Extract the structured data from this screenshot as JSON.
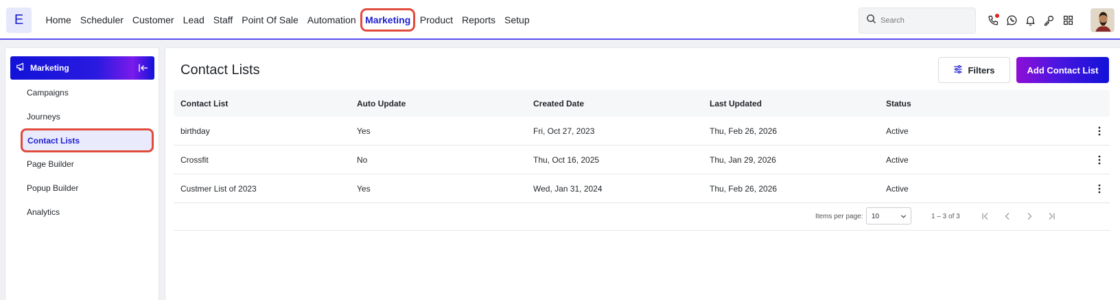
{
  "app": {
    "logo_letter": "E"
  },
  "nav": {
    "items": [
      {
        "label": "Home",
        "active": false
      },
      {
        "label": "Scheduler",
        "active": false
      },
      {
        "label": "Customer",
        "active": false
      },
      {
        "label": "Lead",
        "active": false
      },
      {
        "label": "Staff",
        "active": false
      },
      {
        "label": "Point Of Sale",
        "active": false
      },
      {
        "label": "Automation",
        "active": false
      },
      {
        "label": "Marketing",
        "active": true
      },
      {
        "label": "Product",
        "active": false
      },
      {
        "label": "Reports",
        "active": false
      },
      {
        "label": "Setup",
        "active": false
      }
    ],
    "search_placeholder": "Search",
    "icons": [
      "phone-icon",
      "whatsapp-icon",
      "bell-icon",
      "key-icon",
      "apps-grid-icon"
    ]
  },
  "sidebar": {
    "title": "Marketing",
    "items": [
      {
        "label": "Campaigns",
        "active": false
      },
      {
        "label": "Journeys",
        "active": false
      },
      {
        "label": "Contact Lists",
        "active": true
      },
      {
        "label": "Page Builder",
        "active": false
      },
      {
        "label": "Popup Builder",
        "active": false
      },
      {
        "label": "Analytics",
        "active": false
      }
    ]
  },
  "main": {
    "title": "Contact Lists",
    "filters_label": "Filters",
    "add_label": "Add Contact List",
    "table": {
      "headers": [
        "Contact List",
        "Auto Update",
        "Created Date",
        "Last Updated",
        "Status"
      ],
      "rows": [
        [
          "birthday",
          "Yes",
          "Fri, Oct 27, 2023",
          "Thu, Feb 26, 2026",
          "Active"
        ],
        [
          "Crossfit",
          "No",
          "Thu, Oct 16, 2025",
          "Thu, Jan 29, 2026",
          "Active"
        ],
        [
          "Custmer List of 2023",
          "Yes",
          "Wed, Jan 31, 2024",
          "Thu, Feb 26, 2026",
          "Active"
        ]
      ]
    },
    "pagination": {
      "items_per_page_label": "Items per page:",
      "items_per_page_value": "10",
      "range": "1 – 3 of 3"
    }
  },
  "colors": {
    "accent": "#1e1fd1",
    "highlight_outline": "#e04b3c",
    "notification_dot": "#e0241b"
  }
}
